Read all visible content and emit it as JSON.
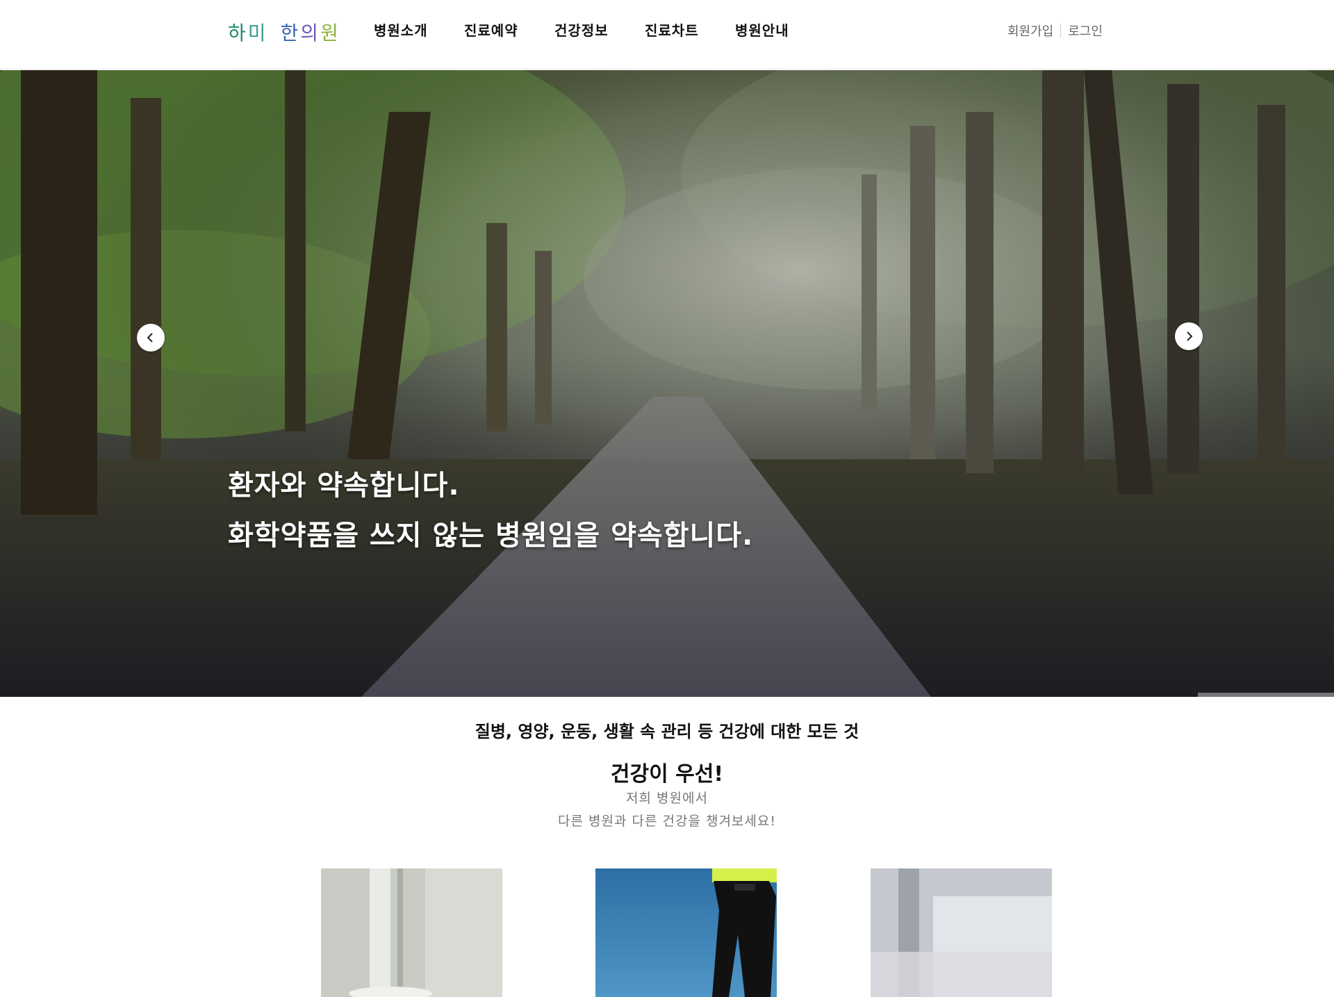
{
  "header": {
    "logo": {
      "chars": [
        "하",
        "미",
        "한",
        "의",
        "원"
      ],
      "colors": [
        "#1a8a6a",
        "#3a9a8c",
        "#3464b8",
        "#6a5ab8",
        "#8ab23a"
      ]
    },
    "nav": [
      "병원소개",
      "진료예약",
      "건강정보",
      "진료차트",
      "병원안내"
    ],
    "util": {
      "signup": "회원가입",
      "login": "로그인"
    }
  },
  "hero": {
    "line1": "환자와 약속합니다.",
    "line2": "화학약품을 쓰지 않는 병원임을 약속합니다.",
    "prev_icon": "chevron-left-icon",
    "next_icon": "chevron-right-icon"
  },
  "section": {
    "subtitle": "질병, 영양, 운동, 생활 속 관리 등 건강에 대한 모든 것",
    "title": "건강이 우선!",
    "desc1": "저희 병원에서",
    "desc2": "다른 병원과 다른 건강을 챙겨보세요!"
  }
}
